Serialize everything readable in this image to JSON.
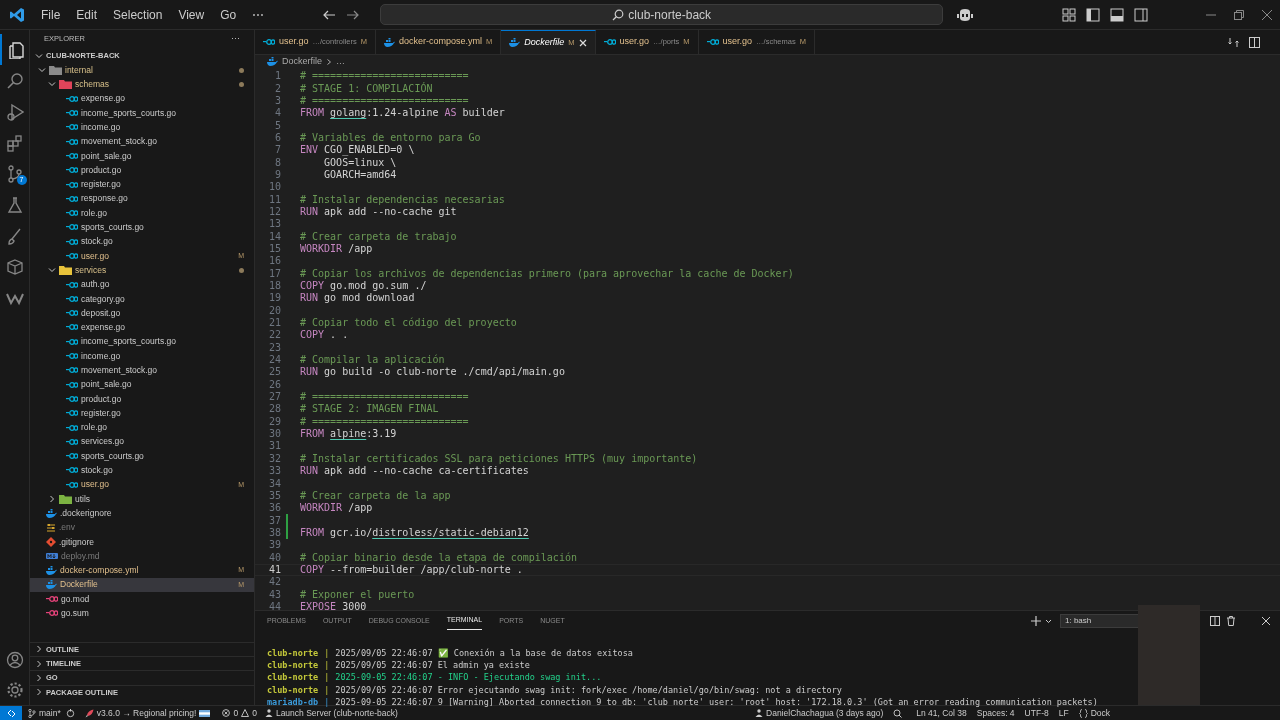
{
  "title_bar": {
    "menu": [
      "File",
      "Edit",
      "Selection",
      "View",
      "Go",
      "⋯"
    ],
    "search": "club-norte-back"
  },
  "activity_bar": {
    "items": [
      {
        "kind": "explorer",
        "selected": true
      },
      {
        "kind": "search",
        "selected": false
      },
      {
        "kind": "debug",
        "selected": false
      },
      {
        "kind": "extensions",
        "selected": false
      },
      {
        "kind": "git",
        "selected": false,
        "badge": "7"
      },
      {
        "kind": "flask",
        "selected": false
      },
      {
        "kind": "brush",
        "selected": false
      },
      {
        "kind": "box",
        "selected": false
      },
      {
        "kind": "w",
        "selected": false
      }
    ]
  },
  "sidebar": {
    "title": "EXPLORER",
    "more": "···",
    "root": "CLUB-NORTE-BACK",
    "tree": [
      {
        "label": "internal",
        "kind": "folder",
        "color": "#8b8b8b",
        "expanded": true,
        "dot": true,
        "selected": false,
        "children": [
          {
            "label": "schemas",
            "kind": "folder",
            "color": "#e0445a",
            "expanded": true,
            "dot": true,
            "selected": false,
            "children": [
              {
                "label": "expense.go",
                "kind": "go",
                "selected": false
              },
              {
                "label": "income_sports_courts.go",
                "kind": "go",
                "selected": false
              },
              {
                "label": "income.go",
                "kind": "go",
                "selected": false
              },
              {
                "label": "movement_stock.go",
                "kind": "go",
                "selected": false
              },
              {
                "label": "point_sale.go",
                "kind": "go",
                "selected": false
              },
              {
                "label": "product.go",
                "kind": "go",
                "selected": false
              },
              {
                "label": "register.go",
                "kind": "go",
                "selected": false
              },
              {
                "label": "response.go",
                "kind": "go",
                "selected": false
              },
              {
                "label": "role.go",
                "kind": "go",
                "selected": false
              },
              {
                "label": "sports_courts.go",
                "kind": "go",
                "selected": false
              },
              {
                "label": "stock.go",
                "kind": "go",
                "selected": false
              },
              {
                "label": "user.go",
                "kind": "go",
                "status": "M",
                "selected": false
              }
            ]
          },
          {
            "label": "services",
            "kind": "folder",
            "color": "#e8c33b",
            "expanded": true,
            "dot": true,
            "selected": false,
            "children": [
              {
                "label": "auth.go",
                "kind": "go",
                "selected": false
              },
              {
                "label": "category.go",
                "kind": "go",
                "selected": false
              },
              {
                "label": "deposit.go",
                "kind": "go",
                "selected": false
              },
              {
                "label": "expense.go",
                "kind": "go",
                "selected": false
              },
              {
                "label": "income_sports_courts.go",
                "kind": "go",
                "selected": false
              },
              {
                "label": "income.go",
                "kind": "go",
                "selected": false
              },
              {
                "label": "movement_stock.go",
                "kind": "go",
                "selected": false
              },
              {
                "label": "point_sale.go",
                "kind": "go",
                "selected": false
              },
              {
                "label": "product.go",
                "kind": "go",
                "selected": false
              },
              {
                "label": "register.go",
                "kind": "go",
                "selected": false
              },
              {
                "label": "role.go",
                "kind": "go",
                "selected": false
              },
              {
                "label": "services.go",
                "kind": "go",
                "selected": false
              },
              {
                "label": "sports_courts.go",
                "kind": "go",
                "selected": false
              },
              {
                "label": "stock.go",
                "kind": "go",
                "selected": false
              },
              {
                "label": "user.go",
                "kind": "go",
                "status": "M",
                "selected": false
              }
            ]
          },
          {
            "label": "utils",
            "kind": "folder",
            "color": "#7cb342",
            "expanded": false,
            "dot": false,
            "selected": false
          }
        ]
      },
      {
        "label": ".dockerignore",
        "kind": "docker",
        "selected": false
      },
      {
        "label": ".env",
        "kind": "env",
        "ignored": true,
        "selected": false
      },
      {
        "label": ".gitignore",
        "kind": "git",
        "selected": false
      },
      {
        "label": "deploy.md",
        "kind": "md",
        "ignored": true,
        "selected": false
      },
      {
        "label": "docker-compose.yml",
        "kind": "docker",
        "status": "M",
        "selected": false
      },
      {
        "label": "Dockerfile",
        "kind": "docker",
        "status": "M",
        "selected": true
      },
      {
        "label": "go.mod",
        "kind": "gomod",
        "selected": false
      },
      {
        "label": "go.sum",
        "kind": "gomod",
        "selected": false
      }
    ],
    "sections": [
      "OUTLINE",
      "TIMELINE",
      "GO",
      "PACKAGE OUTLINE"
    ]
  },
  "tabs": [
    {
      "label": "user.go",
      "path": "…/controllers",
      "kind": "go",
      "status": "M",
      "selected": false
    },
    {
      "label": "docker-compose.yml",
      "kind": "docker",
      "status": "M",
      "selected": false
    },
    {
      "label": "Dockerfile",
      "kind": "docker",
      "status": "M",
      "selected": true
    },
    {
      "label": "user.go",
      "path": "…/ports",
      "kind": "go",
      "status": "M",
      "selected": false
    },
    {
      "label": "user.go",
      "path": "…/schemas",
      "kind": "go",
      "status": "M",
      "selected": false
    }
  ],
  "breadcrumb": [
    "Dockerfile",
    "…"
  ],
  "editor": {
    "lines": [
      {
        "n": "1",
        "segments": [
          {
            "kind": "comment",
            "text": "# =========================="
          }
        ]
      },
      {
        "n": "2",
        "segments": [
          {
            "kind": "comment",
            "text": "# STAGE 1: COMPILACIÓN"
          }
        ]
      },
      {
        "n": "3",
        "segments": [
          {
            "kind": "comment",
            "text": "# =========================="
          }
        ]
      },
      {
        "n": "4",
        "segments": [
          {
            "kind": "keyword",
            "text": "FROM "
          },
          {
            "kind": "image",
            "text": "golang"
          },
          {
            "kind": "plain",
            "text": ":1.24-alpine "
          },
          {
            "kind": "keyword",
            "text": "AS"
          },
          {
            "kind": "plain",
            "text": " builder"
          }
        ]
      },
      {
        "n": "5"
      },
      {
        "n": "6",
        "segments": [
          {
            "kind": "comment",
            "text": "# Variables de entorno para Go"
          }
        ]
      },
      {
        "n": "7",
        "segments": [
          {
            "kind": "keyword",
            "text": "ENV "
          },
          {
            "kind": "plain",
            "text": "CGO_ENABLED=0 \\"
          }
        ]
      },
      {
        "n": "8",
        "segments": [
          {
            "kind": "plain",
            "text": "    GOOS=linux \\"
          }
        ]
      },
      {
        "n": "9",
        "segments": [
          {
            "kind": "plain",
            "text": "    GOARCH=amd64"
          }
        ]
      },
      {
        "n": "10"
      },
      {
        "n": "11",
        "segments": [
          {
            "kind": "comment",
            "text": "# Instalar dependencias necesarias"
          }
        ]
      },
      {
        "n": "12",
        "segments": [
          {
            "kind": "keyword",
            "text": "RUN "
          },
          {
            "kind": "plain",
            "text": "apk add --no-cache git"
          }
        ]
      },
      {
        "n": "13"
      },
      {
        "n": "14",
        "segments": [
          {
            "kind": "comment",
            "text": "# Crear carpeta de trabajo"
          }
        ]
      },
      {
        "n": "15",
        "segments": [
          {
            "kind": "keyword",
            "text": "WORKDIR "
          },
          {
            "kind": "plain",
            "text": "/app"
          }
        ]
      },
      {
        "n": "16"
      },
      {
        "n": "17",
        "segments": [
          {
            "kind": "comment",
            "text": "# Copiar los archivos de dependencias primero (para aprovechar la cache de Docker)"
          }
        ]
      },
      {
        "n": "18",
        "segments": [
          {
            "kind": "keyword",
            "text": "COPY "
          },
          {
            "kind": "plain",
            "text": "go.mod go.sum ./"
          }
        ]
      },
      {
        "n": "19",
        "segments": [
          {
            "kind": "keyword",
            "text": "RUN "
          },
          {
            "kind": "plain",
            "text": "go mod download"
          }
        ]
      },
      {
        "n": "20"
      },
      {
        "n": "21",
        "segments": [
          {
            "kind": "comment",
            "text": "# Copiar todo el código del proyecto"
          }
        ]
      },
      {
        "n": "22",
        "segments": [
          {
            "kind": "keyword",
            "text": "COPY "
          },
          {
            "kind": "plain",
            "text": ". ."
          }
        ]
      },
      {
        "n": "23"
      },
      {
        "n": "24",
        "segments": [
          {
            "kind": "comment",
            "text": "# Compilar la aplicación"
          }
        ]
      },
      {
        "n": "25",
        "segments": [
          {
            "kind": "keyword",
            "text": "RUN "
          },
          {
            "kind": "plain",
            "text": "go build -o club-norte ./cmd/api/main.go"
          }
        ]
      },
      {
        "n": "26"
      },
      {
        "n": "27",
        "segments": [
          {
            "kind": "comment",
            "text": "# =========================="
          }
        ]
      },
      {
        "n": "28",
        "segments": [
          {
            "kind": "comment",
            "text": "# STAGE 2: IMAGEN FINAL"
          }
        ]
      },
      {
        "n": "29",
        "segments": [
          {
            "kind": "comment",
            "text": "# =========================="
          }
        ]
      },
      {
        "n": "30",
        "segments": [
          {
            "kind": "keyword",
            "text": "FROM "
          },
          {
            "kind": "image",
            "text": "alpine"
          },
          {
            "kind": "plain",
            "text": ":3.19"
          }
        ]
      },
      {
        "n": "31"
      },
      {
        "n": "32",
        "segments": [
          {
            "kind": "comment",
            "text": "# Instalar certificados SSL para peticiones HTTPS (muy importante)"
          }
        ]
      },
      {
        "n": "33",
        "segments": [
          {
            "kind": "keyword",
            "text": "RUN "
          },
          {
            "kind": "plain",
            "text": "apk add --no-cache ca-certificates"
          }
        ]
      },
      {
        "n": "34"
      },
      {
        "n": "35",
        "segments": [
          {
            "kind": "comment",
            "text": "# Crear carpeta de la app"
          }
        ]
      },
      {
        "n": "36",
        "segments": [
          {
            "kind": "keyword",
            "text": "WORKDIR "
          },
          {
            "kind": "plain",
            "text": "/app"
          }
        ]
      },
      {
        "n": "37",
        "added": true
      },
      {
        "n": "38",
        "added": true,
        "segments": [
          {
            "kind": "keyword",
            "text": "FROM "
          },
          {
            "kind": "plain",
            "text": "gcr.io/"
          },
          {
            "kind": "image",
            "text": "distroless/static-debian12"
          }
        ]
      },
      {
        "n": "39"
      },
      {
        "n": "40",
        "segments": [
          {
            "kind": "comment",
            "text": "# Copiar binario desde la etapa de compilación"
          }
        ]
      },
      {
        "n": "41",
        "current": true,
        "segments": [
          {
            "kind": "keyword",
            "text": "COPY "
          },
          {
            "kind": "plain",
            "text": "--from=builder /app/club-norte ."
          }
        ]
      },
      {
        "n": "42"
      },
      {
        "n": "43",
        "segments": [
          {
            "kind": "comment",
            "text": "# Exponer el puerto"
          }
        ]
      },
      {
        "n": "44",
        "segments": [
          {
            "kind": "keyword",
            "text": "EXPOSE "
          },
          {
            "kind": "plain",
            "text": "3000"
          }
        ]
      }
    ]
  },
  "panel": {
    "tabs": [
      {
        "label": "PROBLEMS",
        "selected": false
      },
      {
        "label": "OUTPUT",
        "selected": false
      },
      {
        "label": "DEBUG CONSOLE",
        "selected": false
      },
      {
        "label": "TERMINAL",
        "selected": true
      },
      {
        "label": "PORTS",
        "selected": false
      },
      {
        "label": "NUGET",
        "selected": false
      }
    ],
    "terminal_select": "1: bash",
    "lines": [
      {
        "source": "club-norte",
        "color": "#c5c93a",
        "sep": "|",
        "message": "2025/09/05 22:46:07 ✅ Conexión a la base de datos exitosa",
        "kind": "normal"
      },
      {
        "source": "club-norte",
        "color": "#c5c93a",
        "sep": "|",
        "message": "2025/09/05 22:46:07 El admin ya existe",
        "kind": "normal"
      },
      {
        "source": "club-norte",
        "color": "#c5c93a",
        "sep": "|",
        "message": "2025-09-05 22:46:07 - INFO - Ejecutando swag init...",
        "kind": "info"
      },
      {
        "source": "club-norte",
        "color": "#c5c93a",
        "sep": "|",
        "message": "2025/09/05 22:46:07 Error ejecutando swag init: fork/exec /home/daniel/go/bin/swag: not a directory",
        "kind": "normal"
      },
      {
        "source": "mariadb-db",
        "color": "#3b9ad9",
        "sep": "|",
        "message": "2025-09-05 22:46:07 9 [Warning] Aborted connection 9 to db: 'club norte' user: 'root' host: '172.18.0.3' (Got an error reading communication packets)",
        "kind": "normal"
      }
    ]
  },
  "status_bar": {
    "branch": "main*",
    "extension": "v3.6.0 → Regional pricing!",
    "errors": "0",
    "warnings": "0",
    "launch": "Launch Server (club-norte-back)",
    "blame": "DanielChachagua (3 days ago)",
    "position": "Ln 41, Col 38",
    "spaces": "Spaces: 4",
    "encoding": "UTF-8",
    "eol": "LF",
    "language": "Dock"
  }
}
